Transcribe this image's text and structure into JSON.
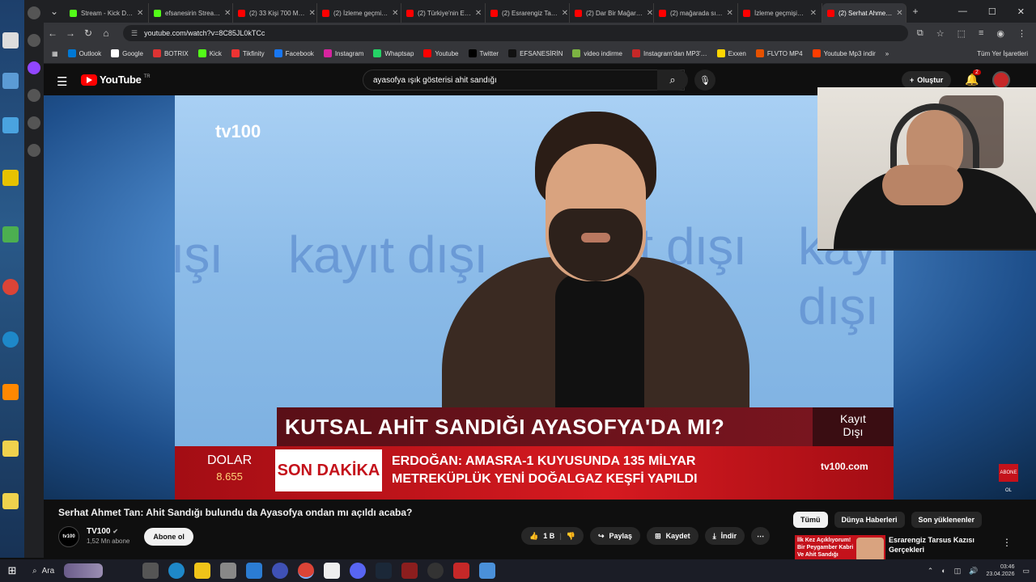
{
  "browser": {
    "tabs": [
      {
        "label": "Stream - Kick D…",
        "color": "#53fc18"
      },
      {
        "label": "efsanesirin Strea…",
        "color": "#53fc18"
      },
      {
        "label": "(2) 33 Kişi 700 M…",
        "color": "#ff0000"
      },
      {
        "label": "(2) İzleme geçmi…",
        "color": "#ff0000"
      },
      {
        "label": "(2) Türkiye'nin E…",
        "color": "#ff0000"
      },
      {
        "label": "(2) Esrarengiz Ta…",
        "color": "#ff0000"
      },
      {
        "label": "(2) Dar Bir Mağar…",
        "color": "#ff0000"
      },
      {
        "label": "(2) mağarada sı…",
        "color": "#ff0000"
      },
      {
        "label": "İzleme geçmişi…",
        "color": "#ff0000"
      },
      {
        "label": "(2) Serhat Ahme…",
        "color": "#ff0000",
        "active": true
      }
    ],
    "new_tab": "+",
    "url": "youtube.com/watch?v=8C85JL0kTCc",
    "bookmarks": [
      {
        "label": "Outlook",
        "color": "#0078d4"
      },
      {
        "label": "Google",
        "color": "#ffffff"
      },
      {
        "label": "BOTRIX",
        "color": "#d33"
      },
      {
        "label": "Kick",
        "color": "#53fc18"
      },
      {
        "label": "Tikfinity",
        "color": "#e33"
      },
      {
        "label": "Facebook",
        "color": "#1877f2"
      },
      {
        "label": "Instagram",
        "color": "#d6249f"
      },
      {
        "label": "Whaptsap",
        "color": "#25d366"
      },
      {
        "label": "Youtube",
        "color": "#ff0000"
      },
      {
        "label": "Twitter",
        "color": "#000000"
      },
      {
        "label": "EFSANESİRİN",
        "color": "#111111"
      },
      {
        "label": "video indirme",
        "color": "#7cb342"
      },
      {
        "label": "Instagram'dan MP3'…",
        "color": "#c62828"
      },
      {
        "label": "Exxen",
        "color": "#ffd600"
      },
      {
        "label": "FLVTO MP4",
        "color": "#e65100"
      },
      {
        "label": "Youtube Mp3 indir",
        "color": "#ff3d00"
      }
    ],
    "other_bookmarks": "Tüm Yer İşaretleri"
  },
  "youtube": {
    "logo": "YouTube",
    "region": "TR",
    "search_query": "ayasofya ışık gösterisi ahit sandığı",
    "create_label": "Oluştur",
    "notif_count": "2"
  },
  "video": {
    "channel_logo": "tv100",
    "bg_text": [
      "dışı",
      "kayıt dışı",
      "kayıt dışı",
      "kayıt dışı"
    ],
    "headline": "KUTSAL AHİT SANDIĞI AYASOFYA'DA MI?",
    "program": [
      "Kayıt",
      "Dışı"
    ],
    "dolar_label": "DOLAR",
    "dolar_value": "8.655",
    "breaking": "SON DAKİKA",
    "ticker_line1": "ERDOĞAN: AMASRA-1 KUYUSUNDA 135 MİLYAR",
    "ticker_line2": "METREKÜPLÜK YENİ DOĞALGAZ KEŞFİ YAPILDI",
    "site": "tv100.com",
    "corner": "ABONE OL"
  },
  "details": {
    "title": "Serhat Ahmet Tan: Ahit Sandığı bulundu da Ayasofya ondan mı açıldı acaba?",
    "channel": "TV100",
    "subscribers": "1,52 Mn abone",
    "subscribe": "Abone ol",
    "likes": "1 B",
    "share": "Paylaş",
    "save": "Kaydet",
    "download": "İndir"
  },
  "recommend": {
    "chips": [
      "Tümü",
      "Dünya Haberleri",
      "Son yüklenenler"
    ],
    "thumb_text": "İlk Kez Açıklıyorum! Bir Peygamber Kabri Ve Ahit Sandığı",
    "title": "Esrarengiz Tarsus Kazısı Gerçekleri"
  },
  "taskbar": {
    "search": "Ara",
    "time": "03:46",
    "date": "23.04.2026"
  }
}
